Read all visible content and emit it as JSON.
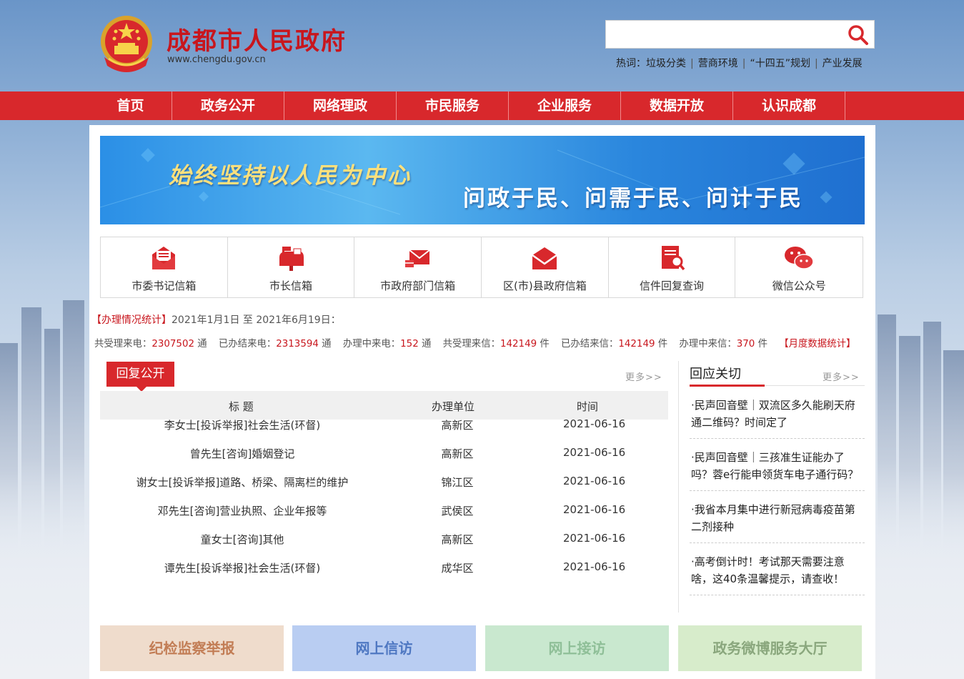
{
  "header": {
    "site_title": "成都市人民政府",
    "site_url": "www.chengdu.gov.cn",
    "search_placeholder": "",
    "hot_label": "热词：",
    "hotwords": [
      "垃圾分类",
      "营商环境",
      "“十四五”规划",
      "产业发展"
    ]
  },
  "nav": {
    "items": [
      "首页",
      "政务公开",
      "网络理政",
      "市民服务",
      "企业服务",
      "数据开放",
      "认识成都"
    ]
  },
  "banner": {
    "slogan1": "始终坚持以人民为中心",
    "slogan2": "问政于民、问需于民、问计于民"
  },
  "mailboxes": {
    "items": [
      {
        "label": "市委书记信箱",
        "icon": "envelope-open-icon"
      },
      {
        "label": "市长信箱",
        "icon": "mailbox-flag-icon"
      },
      {
        "label": "市政府部门信箱",
        "icon": "send-letter-icon"
      },
      {
        "label": "区(市)县政府信箱",
        "icon": "envelope-icon"
      },
      {
        "label": "信件回复查询",
        "icon": "document-search-icon"
      },
      {
        "label": "微信公众号",
        "icon": "wechat-icon"
      }
    ]
  },
  "stats": {
    "title": "【办理情况统计】",
    "range": "2021年1月1日 至 2021年6月19日：",
    "items": [
      {
        "label": "共受理来电：",
        "value": "2307502",
        "unit": "通"
      },
      {
        "label": "已办结来电：",
        "value": "2313594",
        "unit": "通"
      },
      {
        "label": "办理中来电：",
        "value": "152",
        "unit": "通"
      },
      {
        "label": "共受理来信：",
        "value": "142149",
        "unit": "件"
      },
      {
        "label": "已办结来信：",
        "value": "142149",
        "unit": "件"
      },
      {
        "label": "办理中来信：",
        "value": "370",
        "unit": "件"
      }
    ],
    "monthly": "【月度数据统计】"
  },
  "reply": {
    "tab": "回复公开",
    "more": "更多>>",
    "headers": [
      "标 题",
      "办理单位",
      "时间"
    ],
    "rows": [
      {
        "title": "李女士[投诉举报]社会生活(环督)",
        "unit": "高新区",
        "date": "2021-06-16"
      },
      {
        "title": "曾先生[咨询]婚姻登记",
        "unit": "高新区",
        "date": "2021-06-16"
      },
      {
        "title": "谢女士[投诉举报]道路、桥梁、隔离栏的维护",
        "unit": "锦江区",
        "date": "2021-06-16"
      },
      {
        "title": "邓先生[咨询]营业执照、企业年报等",
        "unit": "武侯区",
        "date": "2021-06-16"
      },
      {
        "title": "童女士[咨询]其他",
        "unit": "高新区",
        "date": "2021-06-16"
      },
      {
        "title": "谭先生[投诉举报]社会生活(环督)",
        "unit": "成华区",
        "date": "2021-06-16"
      }
    ]
  },
  "response": {
    "title": "回应关切",
    "more": "更多>>",
    "items": [
      "·民声回音壁｜双流区多久能刷天府通二维码？时间定了",
      "·民声回音壁｜三孩准生证能办了吗？蓉e行能申领货车电子通行码？",
      "·我省本月集中进行新冠病毒疫苗第二剂接种",
      "·高考倒计时！考试那天需要注意啥，这40条温馨提示，请查收！"
    ]
  },
  "quicklinks": {
    "items": [
      {
        "label": "纪检监察举报",
        "bg": "#efdccc",
        "color": "#c27d55"
      },
      {
        "label": "网上信访",
        "bg": "#b9cdf2",
        "color": "#4f78c2"
      },
      {
        "label": "网上接访",
        "bg": "#c9e8cf",
        "color": "#8fbf98"
      },
      {
        "label": "政务微博服务大厅",
        "bg": "#d7eccb",
        "color": "#8aa77d"
      }
    ]
  },
  "colors": {
    "brand_red": "#d8282c",
    "title_red": "#c8161d"
  }
}
